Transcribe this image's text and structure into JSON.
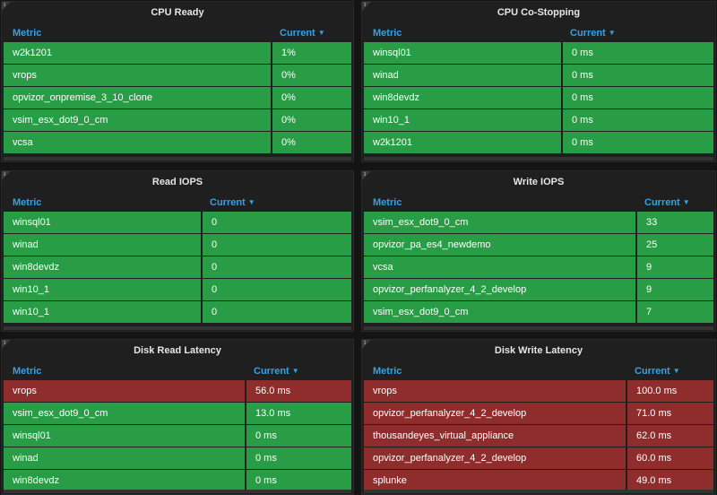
{
  "colors": {
    "ok": "#299c46",
    "warn": "#8f2d2d",
    "header": "#33a2e5"
  },
  "header_labels": {
    "metric": "Metric",
    "current": "Current",
    "sort_icon": "caret-down-icon"
  },
  "info_glyph": "i",
  "panels": [
    {
      "title": "CPU Ready",
      "rows": [
        {
          "metric": "w2k1201",
          "value": "1%",
          "status": "ok"
        },
        {
          "metric": "vrops",
          "value": "0%",
          "status": "ok"
        },
        {
          "metric": "opvizor_onpremise_3_10_clone",
          "value": "0%",
          "status": "ok"
        },
        {
          "metric": "vsim_esx_dot9_0_cm",
          "value": "0%",
          "status": "ok"
        },
        {
          "metric": "vcsa",
          "value": "0%",
          "status": "ok"
        }
      ]
    },
    {
      "title": "CPU Co-Stopping",
      "rows": [
        {
          "metric": "winsql01",
          "value": "0 ms",
          "status": "ok"
        },
        {
          "metric": "winad",
          "value": "0 ms",
          "status": "ok"
        },
        {
          "metric": "win8devdz",
          "value": "0 ms",
          "status": "ok"
        },
        {
          "metric": "win10_1",
          "value": "0 ms",
          "status": "ok"
        },
        {
          "metric": "w2k1201",
          "value": "0 ms",
          "status": "ok"
        }
      ]
    },
    {
      "title": "Read IOPS",
      "rows": [
        {
          "metric": "winsql01",
          "value": "0",
          "status": "ok"
        },
        {
          "metric": "winad",
          "value": "0",
          "status": "ok"
        },
        {
          "metric": "win8devdz",
          "value": "0",
          "status": "ok"
        },
        {
          "metric": "win10_1",
          "value": "0",
          "status": "ok"
        },
        {
          "metric": "win10_1",
          "value": "0",
          "status": "ok"
        }
      ]
    },
    {
      "title": "Write IOPS",
      "rows": [
        {
          "metric": "vsim_esx_dot9_0_cm",
          "value": "33",
          "status": "ok"
        },
        {
          "metric": "opvizor_pa_es4_newdemo",
          "value": "25",
          "status": "ok"
        },
        {
          "metric": "vcsa",
          "value": "9",
          "status": "ok"
        },
        {
          "metric": "opvizor_perfanalyzer_4_2_develop",
          "value": "9",
          "status": "ok"
        },
        {
          "metric": "vsim_esx_dot9_0_cm",
          "value": "7",
          "status": "ok"
        }
      ]
    },
    {
      "title": "Disk Read Latency",
      "rows": [
        {
          "metric": "vrops",
          "value": "56.0 ms",
          "status": "warn"
        },
        {
          "metric": "vsim_esx_dot9_0_cm",
          "value": "13.0 ms",
          "status": "ok"
        },
        {
          "metric": "winsql01",
          "value": "0 ms",
          "status": "ok"
        },
        {
          "metric": "winad",
          "value": "0 ms",
          "status": "ok"
        },
        {
          "metric": "win8devdz",
          "value": "0 ms",
          "status": "ok"
        }
      ]
    },
    {
      "title": "Disk Write Latency",
      "rows": [
        {
          "metric": "vrops",
          "value": "100.0 ms",
          "status": "warn"
        },
        {
          "metric": "opvizor_perfanalyzer_4_2_develop",
          "value": "71.0 ms",
          "status": "warn"
        },
        {
          "metric": "thousandeyes_virtual_appliance",
          "value": "62.0 ms",
          "status": "warn"
        },
        {
          "metric": "opvizor_perfanalyzer_4_2_develop",
          "value": "60.0 ms",
          "status": "warn"
        },
        {
          "metric": "splunke",
          "value": "49.0 ms",
          "status": "warn"
        }
      ]
    }
  ]
}
